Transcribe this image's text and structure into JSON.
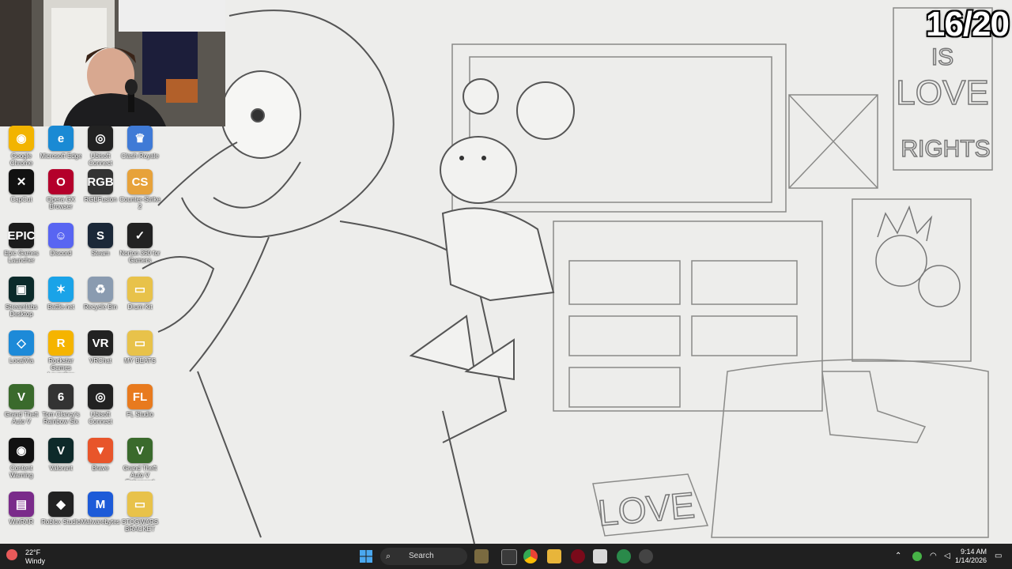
{
  "overlay": {
    "counter": "16/20"
  },
  "wallpaper": {
    "poster_top": [
      "IS",
      "LOVE",
      "RIGHTS"
    ],
    "floor_sign": "LOVE"
  },
  "desktop_icons": [
    {
      "name": "Google Chrome",
      "color": "#f2b400",
      "glyph": "◉"
    },
    {
      "name": "Microsoft Edge",
      "color": "#1a8ad4",
      "glyph": "e"
    },
    {
      "name": "Ubisoft Connect",
      "color": "#222",
      "glyph": "◎"
    },
    {
      "name": "Clash Royale",
      "color": "#3f7ad6",
      "glyph": "♛"
    },
    {
      "name": "CapCut",
      "color": "#111",
      "glyph": "✕"
    },
    {
      "name": "Opera GX Browser",
      "color": "#b4002b",
      "glyph": "O"
    },
    {
      "name": "RGBFusion",
      "color": "#333",
      "glyph": "RGB"
    },
    {
      "name": "Counter-Strike 2",
      "color": "#e7a23a",
      "glyph": "CS"
    },
    {
      "name": "Epic Games Launcher",
      "color": "#1b1b1b",
      "glyph": "EPIC"
    },
    {
      "name": "Discord",
      "color": "#5865f2",
      "glyph": "☺"
    },
    {
      "name": "Steam",
      "color": "#1b2838",
      "glyph": "S"
    },
    {
      "name": "Norton 360 for Gamers",
      "color": "#222",
      "glyph": "✓"
    },
    {
      "name": "Streamlabs Desktop",
      "color": "#0b2a2a",
      "glyph": "▣"
    },
    {
      "name": "Battle.net",
      "color": "#1aa3e8",
      "glyph": "✶"
    },
    {
      "name": "Recycle Bin",
      "color": "#8a9bb0",
      "glyph": "♻"
    },
    {
      "name": "Drum Kit",
      "color": "#e8c24a",
      "glyph": "▭"
    },
    {
      "name": "LocalVia",
      "color": "#1d8ad8",
      "glyph": "◇"
    },
    {
      "name": "Rockstar Games Launcher",
      "color": "#f5b400",
      "glyph": "R"
    },
    {
      "name": "VRChat",
      "color": "#222",
      "glyph": "VR"
    },
    {
      "name": "MY BEATS",
      "color": "#e8c24a",
      "glyph": "▭"
    },
    {
      "name": "Grand Theft Auto V",
      "color": "#3a6a2c",
      "glyph": "V"
    },
    {
      "name": "Tom Clancy's Rainbow Six",
      "color": "#333",
      "glyph": "6"
    },
    {
      "name": "Ubisoft Connect",
      "color": "#222",
      "glyph": "◎"
    },
    {
      "name": "FL Studio",
      "color": "#e87a1e",
      "glyph": "FL"
    },
    {
      "name": "Content Warning",
      "color": "#111",
      "glyph": "◉"
    },
    {
      "name": "Valorant",
      "color": "#0e2a2a",
      "glyph": "V"
    },
    {
      "name": "Brave",
      "color": "#e8552a",
      "glyph": "▼"
    },
    {
      "name": "Grand Theft Auto V Enhanced",
      "color": "#3a6a2c",
      "glyph": "V"
    },
    {
      "name": "WinRAR",
      "color": "#7a2b8a",
      "glyph": "▤"
    },
    {
      "name": "Roblox Studio",
      "color": "#222",
      "glyph": "◆"
    },
    {
      "name": "Malwarebytes",
      "color": "#1d5bd8",
      "glyph": "M"
    },
    {
      "name": "STOGWARS BRACKET",
      "color": "#e8c24a",
      "glyph": "▭"
    }
  ],
  "taskbar": {
    "weather_temp": "22°F",
    "weather_desc": "Windy",
    "search_label": "Search",
    "time": "9:14 AM",
    "date": "1/14/2026"
  }
}
